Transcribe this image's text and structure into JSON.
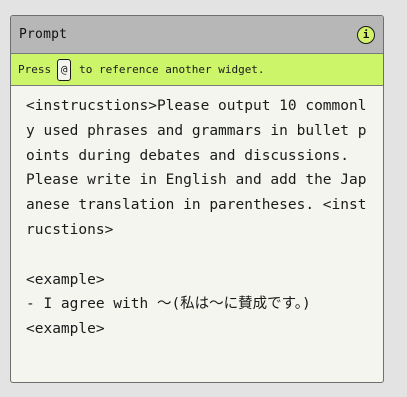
{
  "widget": {
    "title": "Prompt",
    "info_icon": "info-icon",
    "info_glyph": "i",
    "hint_prefix": "Press",
    "hint_key": "@",
    "hint_suffix": "to reference another widget.",
    "prompt_text": "<instrucstions>Please output 10 commonly used phrases and grammars in bullet points during debates and discussions.\nPlease write in English and add the Japanese translation in parentheses. <instrucstions>\n\n<example>\n- I agree with ～(私は～に賛成です。)\n<example>"
  },
  "colors": {
    "accent": "#ccf56a",
    "header_bg": "#b7b7b7",
    "page_bg": "#e3e3e3"
  }
}
